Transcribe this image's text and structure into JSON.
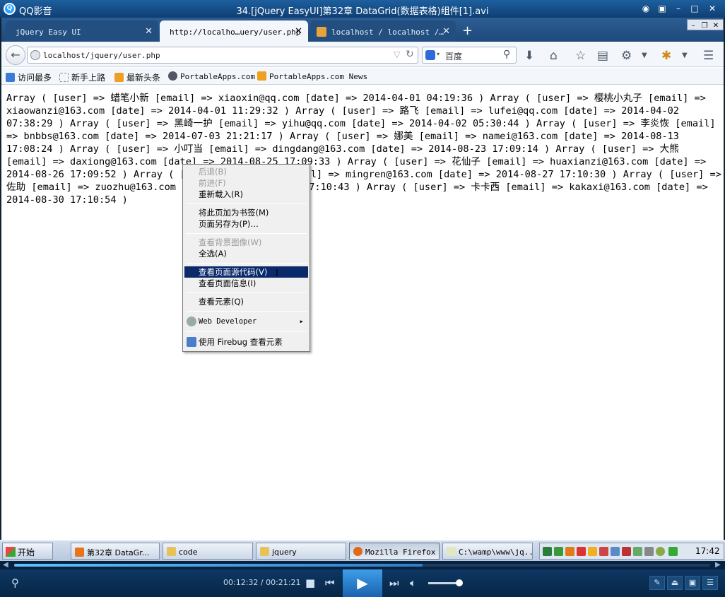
{
  "player": {
    "app_name": "QQ影音",
    "title": "34.[jQuery EasyUI]第32章 DataGrid(数据表格)组件[1].avi",
    "time": "00:12:32 / 00:21:21",
    "progress": 0.587
  },
  "browser": {
    "tabs": [
      {
        "label": "jQuery Easy UI"
      },
      {
        "label": "http://localho…uery/user.php"
      },
      {
        "label": "localhost / localhost /…"
      }
    ],
    "url": "localhost/jquery/user.php",
    "search_placeholder": "百度",
    "bookmarks": [
      "访问最多",
      "新手上路",
      "最新头条",
      "PortableApps.com",
      "PortableApps.com News"
    ]
  },
  "page_content": "Array ( [user] => 蜡笔小新 [email] => xiaoxin@qq.com [date] => 2014-04-01 04:19:36 ) Array ( [user] => 樱桃小丸子 [email] => xiaowanzi@163.com [date] => 2014-04-01 11:29:32 ) Array ( [user] => 路飞 [email] => lufei@qq.com [date] => 2014-04-02 07:38:29 ) Array ( [user] => 黑崎一护 [email] => yihu@qq.com [date] => 2014-04-02 05:30:44 ) Array ( [user] => 李炎恢 [email] => bnbbs@163.com [date] => 2014-07-03 21:21:17 ) Array ( [user] => 娜美 [email] => namei@163.com [date] => 2014-08-13 17:08:24 ) Array ( [user] => 小叮当 [email] => dingdang@163.com [date] => 2014-08-23 17:09:14 ) Array ( [user] => 大熊 [email] => daxiong@163.com [date] => 2014-08-25 17:09:33 ) Array ( [user] => 花仙子 [email] => huaxianzi@163.com [date] => 2014-08-26 17:09:52 ) Array ( [user] => 漩涡鸣人 [email] => mingren@163.com [date] => 2014-08-27 17:10:30 ) Array ( [user] => 佐助 [email] => zuozhu@163.com [date] => 2014-08-28 17:10:43 ) Array ( [user] => 卡卡西 [email] => kakaxi@163.com [date] => 2014-08-30 17:10:54 )",
  "context_menu": {
    "items": [
      {
        "label": "后退(B)"
      },
      {
        "label": "前进(F)"
      },
      {
        "label": "重新载入(R)"
      },
      {
        "label": "将此页加为书签(M)"
      },
      {
        "label": "页面另存为(P)…"
      },
      {
        "label": "查看背景图像(W)"
      },
      {
        "label": "全选(A)"
      },
      {
        "label": "查看页面源代码(V)"
      },
      {
        "label": "查看页面信息(I)"
      },
      {
        "label": "查看元素(Q)"
      },
      {
        "label": "Web Developer"
      },
      {
        "label": "使用 Firebug 查看元素"
      }
    ]
  },
  "taskbar": {
    "start": "开始",
    "tasks": [
      "第32章 DataGr...",
      "code",
      "jquery",
      "Mozilla Firefox",
      "C:\\wamp\\www\\jq..."
    ],
    "clock": "17:42"
  }
}
